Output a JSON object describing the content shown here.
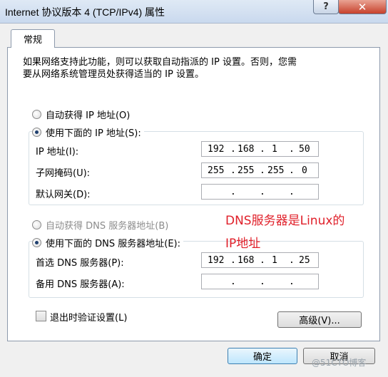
{
  "window": {
    "title": "Internet 协议版本 4 (TCP/IPv4) 属性",
    "help_glyph": "?",
    "close_glyph": "✕"
  },
  "tab": {
    "label": "常规"
  },
  "description": {
    "line1": "如果网络支持此功能，则可以获取自动指派的 IP 设置。否则，您需",
    "line2": "要从网络系统管理员处获得适当的 IP 设置。"
  },
  "ip_section": {
    "auto_label": "自动获得 IP 地址(O)",
    "manual_label": "使用下面的 IP 地址(S):",
    "selected": "manual",
    "fields": [
      {
        "label": "IP 地址(I):",
        "octets": [
          "192",
          "168",
          "1",
          "50"
        ]
      },
      {
        "label": "子网掩码(U):",
        "octets": [
          "255",
          "255",
          "255",
          "0"
        ]
      },
      {
        "label": "默认网关(D):",
        "octets": [
          "",
          "",
          "",
          ""
        ]
      }
    ]
  },
  "dns_section": {
    "auto_label": "自动获得 DNS 服务器地址(B)",
    "manual_label": "使用下面的 DNS 服务器地址(E):",
    "selected": "manual",
    "fields": [
      {
        "label": "首选 DNS 服务器(P):",
        "octets": [
          "192",
          "168",
          "1",
          "25"
        ]
      },
      {
        "label": "备用 DNS 服务器(A):",
        "octets": [
          "",
          "",
          "",
          ""
        ]
      }
    ]
  },
  "annotation": {
    "line1": "DNS服务器是Linux的",
    "line2": "IP地址",
    "color": "#e0202a"
  },
  "validate_checkbox": {
    "label": "退出时验证设置(L)",
    "checked": false
  },
  "advanced_button": {
    "label": "高级(V)..."
  },
  "ok_button": {
    "label": "确定"
  },
  "cancel_button": {
    "label": "取消"
  },
  "watermark": {
    "text": "@51CTO博客"
  }
}
